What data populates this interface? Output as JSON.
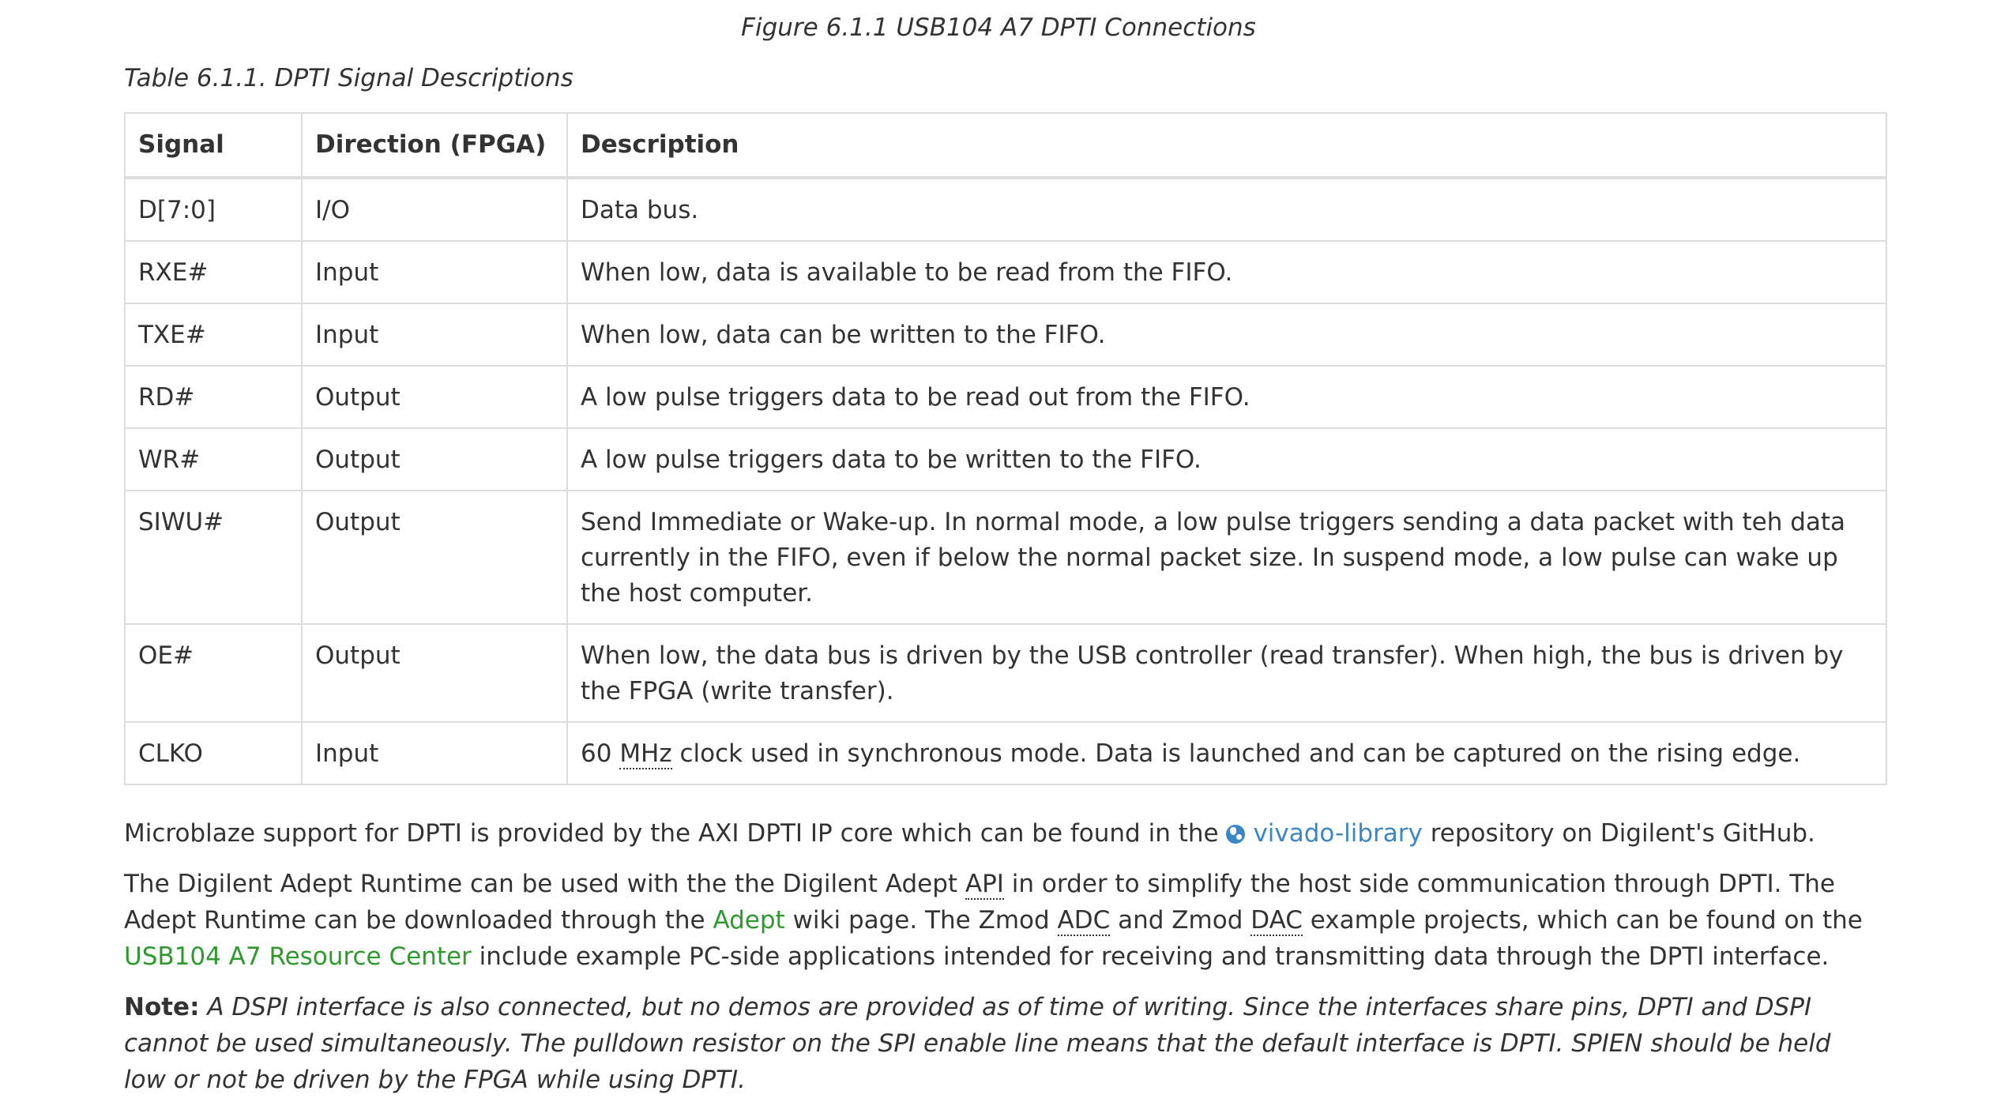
{
  "figure_caption": "Figure 6.1.1 USB104 A7 DPTI Connections",
  "table_caption": "Table 6.1.1. DPTI Signal Descriptions",
  "table": {
    "headers": [
      "Signal",
      "Direction (FPGA)",
      "Description"
    ],
    "rows": [
      {
        "signal": "D[7:0]",
        "direction": "I/O",
        "description": "Data bus."
      },
      {
        "signal": "RXE#",
        "direction": "Input",
        "description": "When low, data is available to be read from the FIFO."
      },
      {
        "signal": "TXE#",
        "direction": "Input",
        "description": "When low, data can be written to the FIFO."
      },
      {
        "signal": "RD#",
        "direction": "Output",
        "description": "A low pulse triggers data to be read out from the FIFO."
      },
      {
        "signal": "WR#",
        "direction": "Output",
        "description": "A low pulse triggers data to be written to the FIFO."
      },
      {
        "signal": "SIWU#",
        "direction": "Output",
        "description": "Send Immediate or Wake-up. In normal mode, a low pulse triggers sending a data packet with teh data currently in the FIFO, even if below the normal packet size. In suspend mode, a low pulse can wake up the host computer."
      },
      {
        "signal": "OE#",
        "direction": "Output",
        "description": "When low, the data bus is driven by the USB controller (read transfer). When high, the bus is driven by the FPGA (write transfer)."
      },
      {
        "signal": "CLKO",
        "direction": "Input",
        "description_before": "60 ",
        "description_abbr": "MHz",
        "description_after": " clock used in synchronous mode. Data is launched and can be captured on the rising edge."
      }
    ]
  },
  "paragraph1": {
    "before": "Microblaze support for DPTI is provided by the AXI DPTI IP core which can be found in the ",
    "link_icon": "globe-icon",
    "link": "vivado-library",
    "after": " repository on Digilent's GitHub."
  },
  "paragraph2": {
    "t1": "The Digilent Adept Runtime can be used with the the Digilent Adept ",
    "abbr_api": "API",
    "t2": " in order to simplify the host side communication through DPTI. The Adept Runtime can be downloaded through the ",
    "link_adept": "Adept",
    "t3": " wiki page. The Zmod ",
    "abbr_adc": "ADC",
    "t4": " and Zmod ",
    "abbr_dac": "DAC",
    "t5": " example projects, which can be found on the ",
    "link_resource": "USB104 A7 Resource Center",
    "t6": " include example PC-side applications intended for receiving and transmitting data through the DPTI interface."
  },
  "note": {
    "label": "Note:",
    "text": " A DSPI interface is also connected, but no demos are provided as of time of writing. Since the interfaces share pins, DPTI and DSPI cannot be used simultaneously. The pulldown resistor on the SPI enable line means that the default interface is DPTI. SPIEN should be held low or not be driven by the FPGA while using DPTI."
  },
  "colors": {
    "text": "#333333",
    "link_external": "#3b86c6",
    "link_internal": "#2e9a2e",
    "table_border": "#dddddd"
  }
}
